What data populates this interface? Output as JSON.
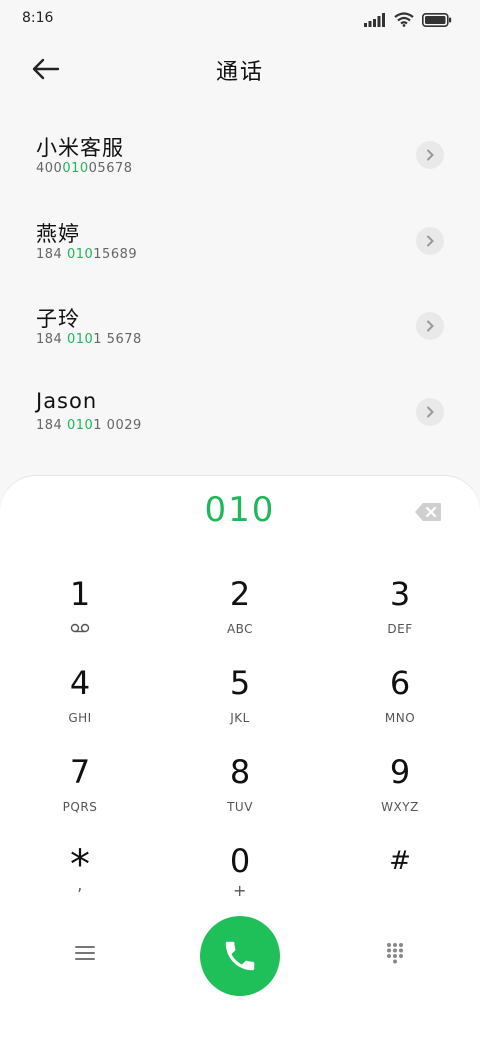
{
  "status": {
    "time": "8:16"
  },
  "header": {
    "title": "通话"
  },
  "contacts": [
    {
      "name": "小米客服",
      "num_pre": "400",
      "num_hl": "010",
      "num_post": "05678"
    },
    {
      "name": "燕婷",
      "num_pre": "184 ",
      "num_hl": "010",
      "num_post": "15689"
    },
    {
      "name": "子玲",
      "num_pre": "184 ",
      "num_hl": "010",
      "num_post": "1 5678"
    },
    {
      "name": "Jason",
      "num_pre": "184 ",
      "num_hl": "010",
      "num_post": "1 0029"
    }
  ],
  "dialed": "010",
  "keys": [
    {
      "digit": "1",
      "letters": ""
    },
    {
      "digit": "2",
      "letters": "ABC"
    },
    {
      "digit": "3",
      "letters": "DEF"
    },
    {
      "digit": "4",
      "letters": "GHI"
    },
    {
      "digit": "5",
      "letters": "JKL"
    },
    {
      "digit": "6",
      "letters": "MNO"
    },
    {
      "digit": "7",
      "letters": "PQRS"
    },
    {
      "digit": "8",
      "letters": "TUV"
    },
    {
      "digit": "9",
      "letters": "WXYZ"
    },
    {
      "digit": "*",
      "letters": ","
    },
    {
      "digit": "0",
      "letters": "+"
    },
    {
      "digit": "#",
      "letters": ""
    }
  ],
  "icons": {
    "back": "arrow-left-icon",
    "backspace": "backspace-icon",
    "voicemail": "voicemail-icon",
    "call": "phone-icon",
    "menu": "menu-icon",
    "keypad": "keypad-icon"
  },
  "colors": {
    "accent": "#1eb85a",
    "call_button": "#1fbf5a"
  }
}
